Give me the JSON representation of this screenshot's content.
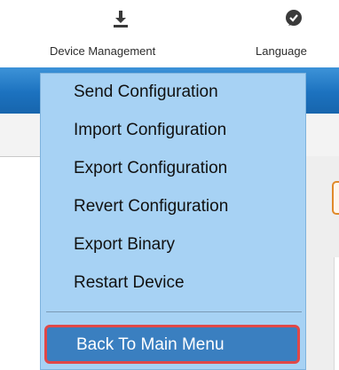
{
  "toolbar": {
    "device_management": {
      "label": "Device Management",
      "icon": "download-icon"
    },
    "language": {
      "label": "Language",
      "icon": "language-icon"
    }
  },
  "menu": {
    "items": [
      "Send Configuration",
      "Import Configuration",
      "Export Configuration",
      "Revert Configuration",
      "Export Binary",
      "Restart Device"
    ],
    "back": "Back To Main Menu"
  },
  "colors": {
    "menu_bg": "#a7d2f4",
    "highlight": "#3a7fc0",
    "highlight_border": "#e04848",
    "header": "#1c72bf"
  }
}
